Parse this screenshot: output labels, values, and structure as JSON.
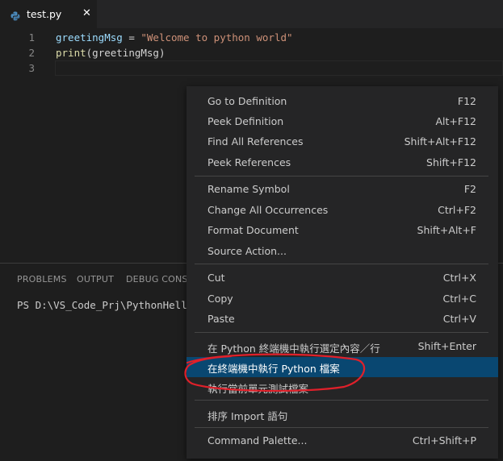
{
  "tab": {
    "label": "test.py",
    "close": "✕",
    "icon": "python-icon"
  },
  "editor": {
    "lines": [
      {
        "num": "1"
      },
      {
        "num": "2"
      },
      {
        "num": "3"
      }
    ],
    "code": {
      "l1_var": "greetingMsg",
      "l1_op": " = ",
      "l1_str": "\"Welcome to python world\"",
      "l2_fn": "print",
      "l2_rest": "(greetingMsg)"
    }
  },
  "panel": {
    "tabs": [
      "PROBLEMS",
      "OUTPUT",
      "DEBUG CONSO"
    ],
    "terminal_text": "PS D:\\VS_Code_Prj\\PythonHello>"
  },
  "menu": {
    "items": [
      {
        "label": "Go to Definition",
        "shortcut": "F12"
      },
      {
        "label": "Peek Definition",
        "shortcut": "Alt+F12"
      },
      {
        "label": "Find All References",
        "shortcut": "Shift+Alt+F12"
      },
      {
        "label": "Peek References",
        "shortcut": "Shift+F12"
      },
      {
        "label": "Rename Symbol",
        "shortcut": "F2"
      },
      {
        "label": "Change All Occurrences",
        "shortcut": "Ctrl+F2"
      },
      {
        "label": "Format Document",
        "shortcut": "Shift+Alt+F"
      },
      {
        "label": "Source Action...",
        "shortcut": ""
      },
      {
        "label": "Cut",
        "shortcut": "Ctrl+X"
      },
      {
        "label": "Copy",
        "shortcut": "Ctrl+C"
      },
      {
        "label": "Paste",
        "shortcut": "Ctrl+V"
      },
      {
        "label": "在 Python 終端機中執行選定內容／行",
        "shortcut": "Shift+Enter"
      },
      {
        "label": "在終端機中執行 Python 檔案",
        "shortcut": ""
      },
      {
        "label": "執行當前單元測試檔案",
        "shortcut": ""
      },
      {
        "label": "排序 Import 語句",
        "shortcut": ""
      },
      {
        "label": "Command Palette...",
        "shortcut": "Ctrl+Shift+P"
      }
    ],
    "selected_index": 12
  },
  "colors": {
    "selection": "#094771",
    "annotation": "#e0202a",
    "string": "#ce9178",
    "function": "#dcdcaa",
    "variable": "#9cdcfe"
  }
}
